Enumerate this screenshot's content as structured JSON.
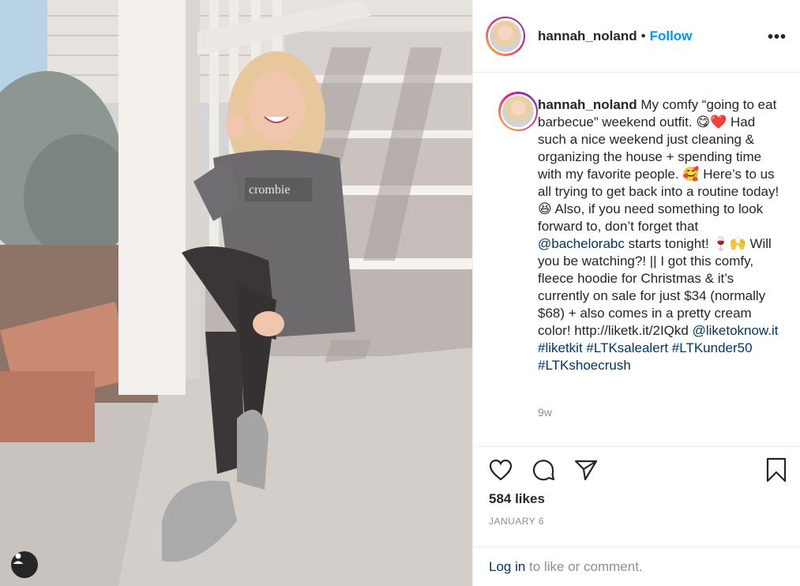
{
  "post": {
    "username": "hannah_noland",
    "separator": "•",
    "follow_label": "Follow",
    "more_label": "•••",
    "caption_parts": [
      "My comfy “going to eat barbecue” weekend outfit. 😋❤️ Had such a nice weekend just cleaning & organizing the house + spending time with my favorite people. 🥰 Here’s to us all trying to get back into a routine today! 😆 Also, if you need something to look forward to, don’t forget that ",
      "@bachelorabc",
      " starts tonight! 🍷🙌 Will you be watching?! || I got this comfy, fleece hoodie for Christmas & it’s currently on sale for just $34 (normally $68) + also comes in a pretty cream color! http://liketk.it/2IQkd ",
      "@liketoknow.it",
      " ",
      "#liketkit",
      " ",
      "#LTKsalealert",
      " ",
      "#LTKunder50",
      " ",
      "#LTKshoecrush"
    ],
    "time_ago": "9w",
    "likes": "584 likes",
    "date": "JANUARY 6",
    "login_link": "Log in",
    "login_text": " to like or comment."
  },
  "icons": {
    "like": "heart-icon",
    "comment": "comment-icon",
    "share": "paper-plane-icon",
    "save": "bookmark-icon",
    "tagged": "user-tag-icon"
  },
  "colors": {
    "follow": "#0095f6",
    "link": "#00376b",
    "muted": "#8e8e8e"
  }
}
